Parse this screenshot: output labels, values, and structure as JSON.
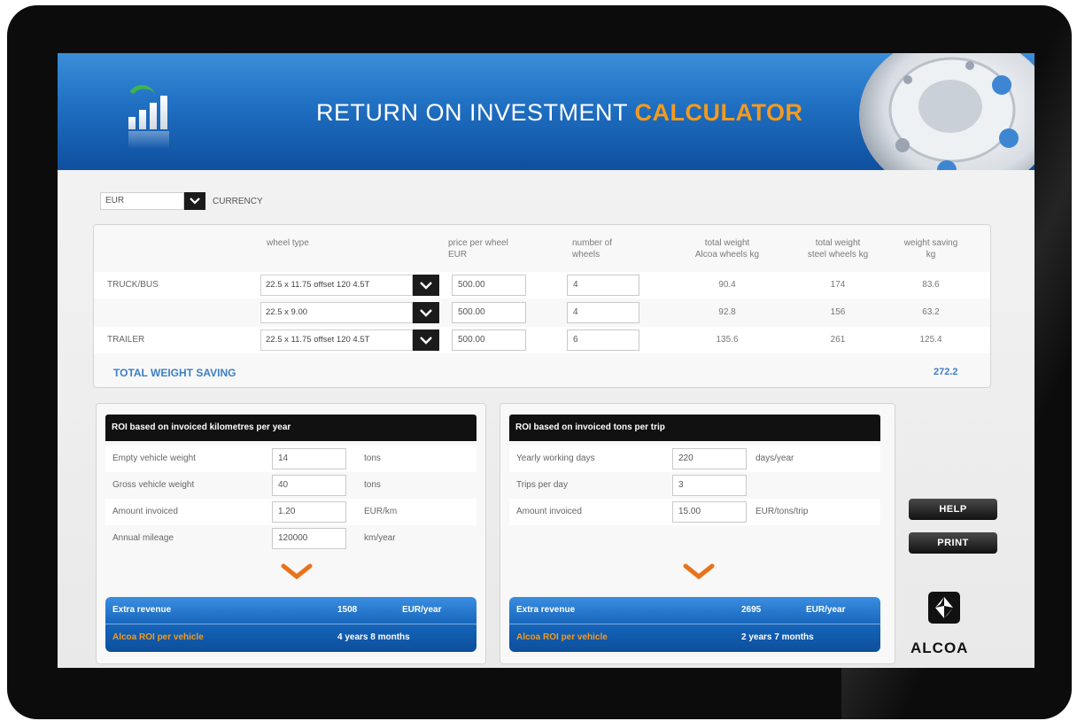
{
  "header": {
    "title_prefix": "RETURN ON INVESTMENT",
    "title_accent": "CALCULATOR"
  },
  "currency": {
    "value": "EUR",
    "label": "CURRENCY"
  },
  "weight_table": {
    "headers": {
      "wheel_type": "wheel type",
      "price_line1": "price per wheel",
      "price_line2": "EUR",
      "number_line1": "number of",
      "number_line2": "wheels",
      "total_alcoa_line1": "total weight",
      "total_alcoa_line2": "Alcoa wheels kg",
      "total_steel_line1": "total weight",
      "total_steel_line2": "steel wheels kg",
      "saving_line1": "weight saving",
      "saving_line2": "kg"
    },
    "rows": [
      {
        "label": "TRUCK/BUS",
        "wheel": "22.5 x 11.75 offset 120 4.5T",
        "price": "500.00",
        "count": "4",
        "alcoa": "90.4",
        "steel": "174",
        "saving": "83.6"
      },
      {
        "label": "",
        "wheel": "22.5 x 9.00",
        "price": "500.00",
        "count": "4",
        "alcoa": "92.8",
        "steel": "156",
        "saving": "63.2"
      },
      {
        "label": "TRAILER",
        "wheel": "22.5 x 11.75 offset 120 4.5T",
        "price": "500.00",
        "count": "6",
        "alcoa": "135.6",
        "steel": "261",
        "saving": "125.4"
      }
    ],
    "total_label": "TOTAL WEIGHT SAVING",
    "total_value": "272.2"
  },
  "roi_km": {
    "title": "ROI based on invoiced kilometres per year",
    "fields": [
      {
        "label": "Empty vehicle weight",
        "value": "14",
        "unit": "tons"
      },
      {
        "label": "Gross vehicle weight",
        "value": "40",
        "unit": "tons"
      },
      {
        "label": "Amount invoiced",
        "value": "1.20",
        "unit": "EUR/km"
      },
      {
        "label": "Annual mileage",
        "value": "120000",
        "unit": "km/year"
      }
    ],
    "extra_revenue_label": "Extra revenue",
    "extra_revenue_value": "1508",
    "extra_revenue_unit": "EUR/year",
    "roi_label": "Alcoa ROI per vehicle",
    "roi_value": "4 years 8 months"
  },
  "roi_tons": {
    "title": "ROI based on invoiced tons per trip",
    "fields": [
      {
        "label": "Yearly working days",
        "value": "220",
        "unit": "days/year"
      },
      {
        "label": "Trips per day",
        "value": "3",
        "unit": ""
      },
      {
        "label": "Amount invoiced",
        "value": "15.00",
        "unit": "EUR/tons/trip"
      }
    ],
    "extra_revenue_label": "Extra revenue",
    "extra_revenue_value": "2695",
    "extra_revenue_unit": "EUR/year",
    "roi_label": "Alcoa ROI per vehicle",
    "roi_value": "2 years 7 months"
  },
  "buttons": {
    "help": "HELP",
    "print": "PRINT"
  },
  "brand": {
    "name": "ALCOA"
  },
  "colors": {
    "header_blue": "#1f6fc2",
    "accent_orange": "#f39a1e",
    "total_blue": "#3b7fc4",
    "panel_black": "#111111"
  }
}
